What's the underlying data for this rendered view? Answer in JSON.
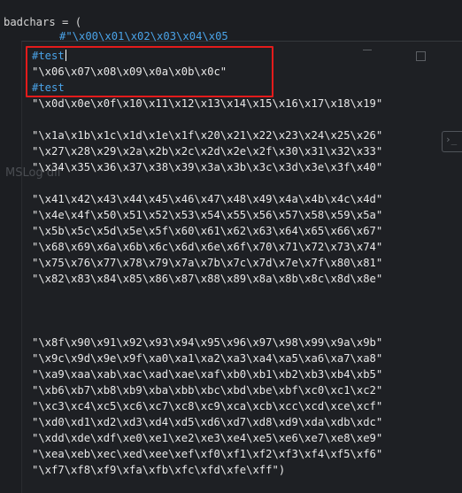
{
  "code": {
    "line_header": "badchars = (",
    "line_comment_chars": "#\"\\x00\\x01\\x02\\x03\\x04\\x05",
    "line_test1": "#test",
    "line_str1": "\"\\x06\\x07\\x08\\x09\\x0a\\x0b\\x0c\"",
    "line_test2": "#test",
    "line_str2": "\"\\x0d\\x0e\\x0f\\x10\\x11\\x12\\x13\\x14\\x15\\x16\\x17\\x18\\x19\"",
    "line_str3": "\"\\x1a\\x1b\\x1c\\x1d\\x1e\\x1f\\x20\\x21\\x22\\x23\\x24\\x25\\x26\"",
    "line_str4": "\"\\x27\\x28\\x29\\x2a\\x2b\\x2c\\x2d\\x2e\\x2f\\x30\\x31\\x32\\x33\"",
    "line_str5": "\"\\x34\\x35\\x36\\x37\\x38\\x39\\x3a\\x3b\\x3c\\x3d\\x3e\\x3f\\x40\"",
    "line_str6": "\"\\x41\\x42\\x43\\x44\\x45\\x46\\x47\\x48\\x49\\x4a\\x4b\\x4c\\x4d\"",
    "line_str7": "\"\\x4e\\x4f\\x50\\x51\\x52\\x53\\x54\\x55\\x56\\x57\\x58\\x59\\x5a\"",
    "line_str8": "\"\\x5b\\x5c\\x5d\\x5e\\x5f\\x60\\x61\\x62\\x63\\x64\\x65\\x66\\x67\"",
    "line_str9": "\"\\x68\\x69\\x6a\\x6b\\x6c\\x6d\\x6e\\x6f\\x70\\x71\\x72\\x73\\x74\"",
    "line_str10": "\"\\x75\\x76\\x77\\x78\\x79\\x7a\\x7b\\x7c\\x7d\\x7e\\x7f\\x80\\x81\"",
    "line_str11": "\"\\x82\\x83\\x84\\x85\\x86\\x87\\x88\\x89\\x8a\\x8b\\x8c\\x8d\\x8e\"",
    "line_str12": "\"\\x8f\\x90\\x91\\x92\\x93\\x94\\x95\\x96\\x97\\x98\\x99\\x9a\\x9b\"",
    "line_str13": "\"\\x9c\\x9d\\x9e\\x9f\\xa0\\xa1\\xa2\\xa3\\xa4\\xa5\\xa6\\xa7\\xa8\"",
    "line_str14": "\"\\xa9\\xaa\\xab\\xac\\xad\\xae\\xaf\\xb0\\xb1\\xb2\\xb3\\xb4\\xb5\"",
    "line_str15": "\"\\xb6\\xb7\\xb8\\xb9\\xba\\xbb\\xbc\\xbd\\xbe\\xbf\\xc0\\xc1\\xc2\"",
    "line_str16": "\"\\xc3\\xc4\\xc5\\xc6\\xc7\\xc8\\xc9\\xca\\xcb\\xcc\\xcd\\xce\\xcf\"",
    "line_str17": "\"\\xd0\\xd1\\xd2\\xd3\\xd4\\xd5\\xd6\\xd7\\xd8\\xd9\\xda\\xdb\\xdc\"",
    "line_str18": "\"\\xdd\\xde\\xdf\\xe0\\xe1\\xe2\\xe3\\xe4\\xe5\\xe6\\xe7\\xe8\\xe9\"",
    "line_str19": "\"\\xea\\xeb\\xec\\xed\\xee\\xef\\xf0\\xf1\\xf2\\xf3\\xf4\\xf5\\xf6\"",
    "line_str20": "\"\\xf7\\xf8\\xf9\\xfa\\xfb\\xfc\\xfd\\xfe\\xff\")"
  },
  "ghost": {
    "background_text": "MSLog dif"
  },
  "colors": {
    "background": "#1c1e22",
    "code_text": "#e8e8e8",
    "comment": "#4aa3e8",
    "highlight_border": "#e31b1b"
  },
  "icons": {
    "minimize": "minimize-icon",
    "maximize": "maximize-icon",
    "terminal": "terminal-icon"
  }
}
